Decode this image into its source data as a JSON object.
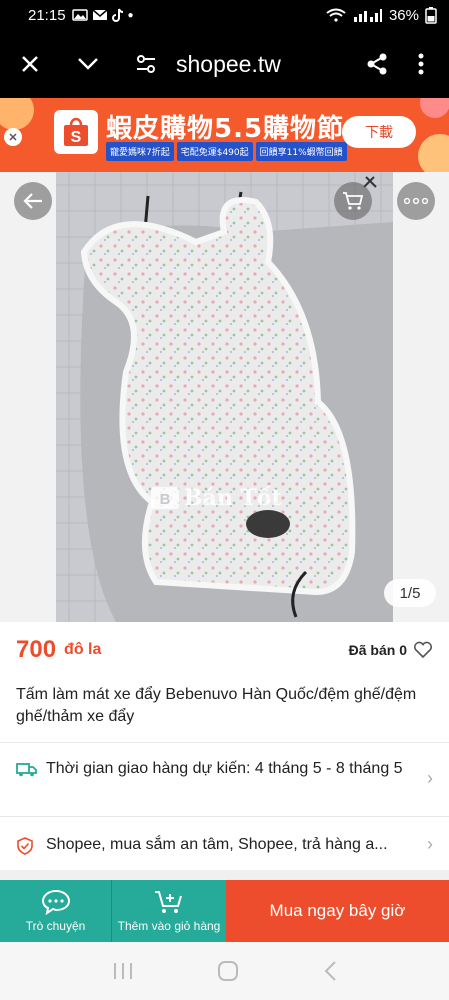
{
  "status_bar": {
    "time": "21:15",
    "battery": "36%"
  },
  "browser": {
    "url": "shopee.tw"
  },
  "banner": {
    "title": "蝦皮購物5.5購物節",
    "chips": [
      "寵愛媽咪7折起",
      "宅配免運$490起",
      "回饋享11%蝦幣回饋"
    ],
    "download_label": "下載",
    "logo_letter": "S"
  },
  "gallery": {
    "pager": "1/5",
    "watermark": "Bán Tốt"
  },
  "product": {
    "price": "700",
    "currency": "đô la",
    "sold": "Đã bán 0",
    "title": "Tấm làm mát xe đẩy Bebenuvo Hàn Quốc/đệm ghế/đệm ghế/thảm xe đẩy"
  },
  "delivery": {
    "text": "Thời gian giao hàng dự kiến: 4 tháng 5 - 8 tháng 5"
  },
  "guarantee": {
    "text": "Shopee, mua sắm an tâm, Shopee, trả hàng a..."
  },
  "actions": {
    "chat_label": "Trò chuyện",
    "cart_label": "Thêm vào giỏ hàng",
    "buy_label": "Mua ngay bây giờ"
  },
  "colors": {
    "accent": "#ee4d2d",
    "teal": "#26aa99",
    "banner": "#f45a2c"
  }
}
